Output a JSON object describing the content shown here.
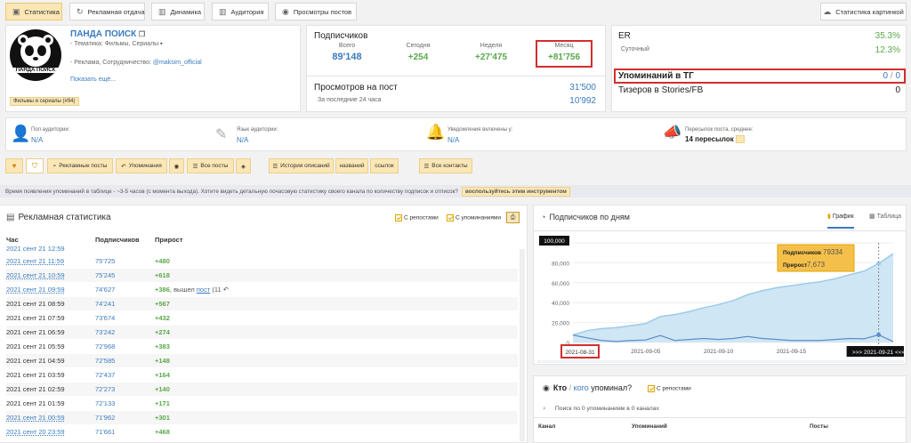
{
  "tabs": [
    {
      "label": "Статистика",
      "icon": "chart-icon"
    },
    {
      "label": "Рекламная отдача",
      "icon": "refresh-icon"
    },
    {
      "label": "Динамика",
      "icon": "bar-icon"
    },
    {
      "label": "Аудитория",
      "icon": "bar-icon"
    },
    {
      "label": "Просмотры постов",
      "icon": "eye-icon"
    }
  ],
  "stat_picture_btn": "Статистика картинкой",
  "channel": {
    "logo_text": "ПАНДА ПОИСК",
    "name": "ПАНДА ПОИСК",
    "topic": "- Тематика: Фильмы, Сериалы",
    "contact_prefix": "- Реклама, Сотрудничество: ",
    "contact_link": "@maksim_official",
    "show_more": "Показать ещё...",
    "category_badge": "Фильмы и сериалы (#94)"
  },
  "subscribers": {
    "title": "Подписчиков",
    "total_label": "Всего",
    "total": "89'148",
    "today_label": "Сегодня",
    "today": "+254",
    "week_label": "Неделя",
    "week": "+27'475",
    "month_label": "Месяц",
    "month": "+81'756"
  },
  "views": {
    "title": "Просмотров на пост",
    "value": "31'500",
    "last24_label": "За последние 24 часа",
    "last24": "10'992"
  },
  "er": {
    "label": "ER",
    "value": "35.3%",
    "daily_label": "Суточный",
    "daily": "12.3%",
    "mentions_label": "Упоминаний в ТГ",
    "mentions_a": "0",
    "mentions_sep": " / ",
    "mentions_b": "0",
    "teasers_label": "Тизеров в Stories/FB",
    "teasers": "0"
  },
  "audience": {
    "gender_label": "Пол аудитории:",
    "gender": "N/A",
    "lang_label": "Язык аудитории:",
    "lang": "N/A",
    "notif_label": "Уведомления включены у:",
    "notif": "N/A",
    "reposts_label": "Пересылок поста, среднее:",
    "reposts": "14 пересылок"
  },
  "action_buttons": {
    "ads": "Рекламные посты",
    "mentions": "Упоминания",
    "all_posts": "Все посты",
    "history": "История описаний",
    "names": "названий",
    "links": "ссылок",
    "contacts": "Все контакты"
  },
  "notice": {
    "text": "Время появления упоминаний в таблице - ~3-5 часов (с момента выхода). Хотите видеть детальную почасовую статистику своего канала по количеству подписок и отписок?",
    "link": "воспользуйтесь этим инструментом"
  },
  "ad_stats": {
    "title": "Рекламная статистика",
    "with_reposts": "С репостами",
    "with_mentions": "С упоминаниями",
    "col_hour": "Час",
    "col_subs": "Подписчиков",
    "col_growth": "Прирост",
    "partial_row": {
      "hour": "2021 сент 21 12:59",
      "subs": "",
      "growth": ""
    },
    "rows": [
      {
        "hour": "2021 сент 21 11:59",
        "subs": "75'725",
        "growth": "+480",
        "link": true
      },
      {
        "hour": "2021 сент 21 10:59",
        "subs": "75'245",
        "growth": "+618",
        "link": true
      },
      {
        "hour": "2021 сент 21 09:59",
        "subs": "74'627",
        "growth": "+386",
        "link": true,
        "extra_prefix": ", вышел ",
        "extra_link": "пост",
        "extra_suffix": " (11"
      },
      {
        "hour": "2021 сент 21 08:59",
        "subs": "74'241",
        "growth": "+567"
      },
      {
        "hour": "2021 сент 21 07:59",
        "subs": "73'674",
        "growth": "+432"
      },
      {
        "hour": "2021 сент 21 06:59",
        "subs": "73'242",
        "growth": "+274"
      },
      {
        "hour": "2021 сент 21 05:59",
        "subs": "72'968",
        "growth": "+383"
      },
      {
        "hour": "2021 сент 21 04:59",
        "subs": "72'585",
        "growth": "+148"
      },
      {
        "hour": "2021 сент 21 03:59",
        "subs": "72'437",
        "growth": "+164"
      },
      {
        "hour": "2021 сент 21 02:59",
        "subs": "72'273",
        "growth": "+140"
      },
      {
        "hour": "2021 сент 21 01:59",
        "subs": "72'133",
        "growth": "+171"
      },
      {
        "hour": "2021 сент 21 00:59",
        "subs": "71'962",
        "growth": "+301",
        "link": true
      },
      {
        "hour": "2021 сент 20 23:59",
        "subs": "71'661",
        "growth": "+468",
        "link": true
      }
    ]
  },
  "subs_chart": {
    "title": "Подписчиков по дням",
    "tab_chart": "График",
    "tab_table": "Таблица",
    "tooltip": {
      "subs_label": "Подписчиков",
      "subs": "79334",
      "growth_label": "Прирост",
      "growth": "7,673"
    },
    "range_start": "2021-08-31",
    "range_end": ">>> 2021-09-21 <<<"
  },
  "chart_data": {
    "type": "area",
    "title": "",
    "x": [
      "2021-08-31",
      "2021-09-01",
      "2021-09-02",
      "2021-09-03",
      "2021-09-04",
      "2021-09-05",
      "2021-09-06",
      "2021-09-07",
      "2021-09-08",
      "2021-09-09",
      "2021-09-10",
      "2021-09-11",
      "2021-09-12",
      "2021-09-13",
      "2021-09-14",
      "2021-09-15",
      "2021-09-16",
      "2021-09-17",
      "2021-09-18",
      "2021-09-19",
      "2021-09-20",
      "2021-09-21",
      "2021-09-22"
    ],
    "xticks": [
      "2021-09-05",
      "2021-09-10",
      "2021-09-15"
    ],
    "series": [
      {
        "name": "Подписчиков",
        "values": [
          7500,
          12000,
          14000,
          15000,
          17000,
          19000,
          26000,
          28000,
          31000,
          35000,
          38000,
          42000,
          48000,
          52000,
          55000,
          57000,
          59000,
          61000,
          64000,
          68000,
          71661,
          79334,
          89148
        ]
      },
      {
        "name": "Прирост",
        "values": [
          7500,
          4500,
          2000,
          1000,
          2000,
          2500,
          7000,
          2000,
          3000,
          4000,
          3000,
          4000,
          6000,
          4000,
          3000,
          2000,
          2000,
          2000,
          3000,
          4000,
          3700,
          7673,
          800
        ]
      }
    ],
    "yticks": [
      "0",
      "20,000",
      "40,000",
      "60,000",
      "80,000",
      "100,000"
    ],
    "ylim": [
      0,
      100000
    ],
    "y_top_label": "100,000"
  },
  "mentions": {
    "who": "Кто",
    "sep": " / ",
    "whom": "кого",
    "suffix": " упоминал?",
    "with_reposts": "С репостами",
    "search_placeholder": "Поиск по 0 упоминаниям в 0 каналах",
    "col_channel": "Канал",
    "col_mentions": "Упоминаний",
    "col_posts": "Посты"
  }
}
